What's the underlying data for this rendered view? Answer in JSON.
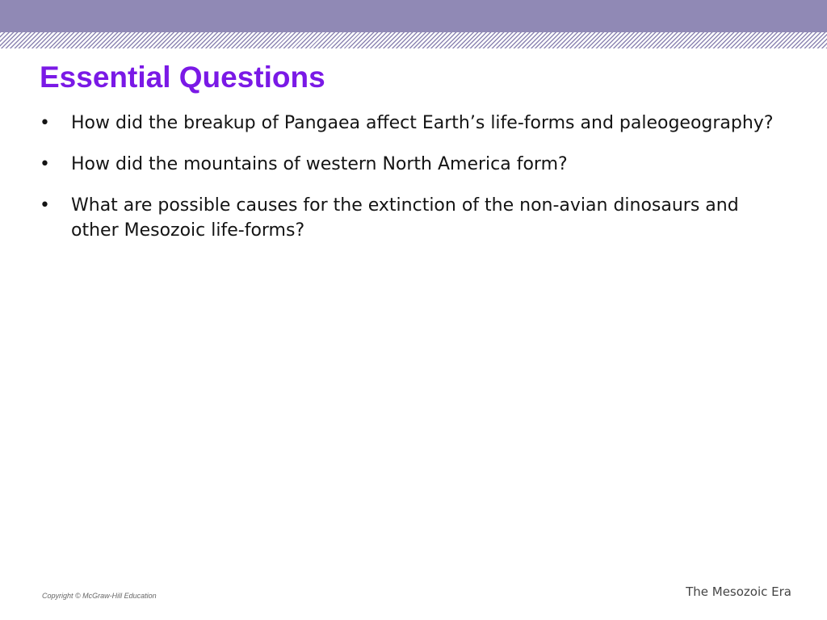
{
  "slide": {
    "title": "Essential Questions",
    "bullets": [
      "How did the breakup of Pangaea affect Earth’s life-forms and paleogeography?",
      "How did the mountains of western North America form?",
      "What are possible causes for the extinction of the non-avian dinosaurs and other Mesozoic life-forms?"
    ],
    "bullet_glyph": "•"
  },
  "footer": {
    "copyright": "Copyright © McGraw-Hill Education",
    "section_title": "The Mesozoic Era"
  },
  "theme": {
    "title_color": "#7a19e6",
    "band_color": "#9089b5"
  }
}
